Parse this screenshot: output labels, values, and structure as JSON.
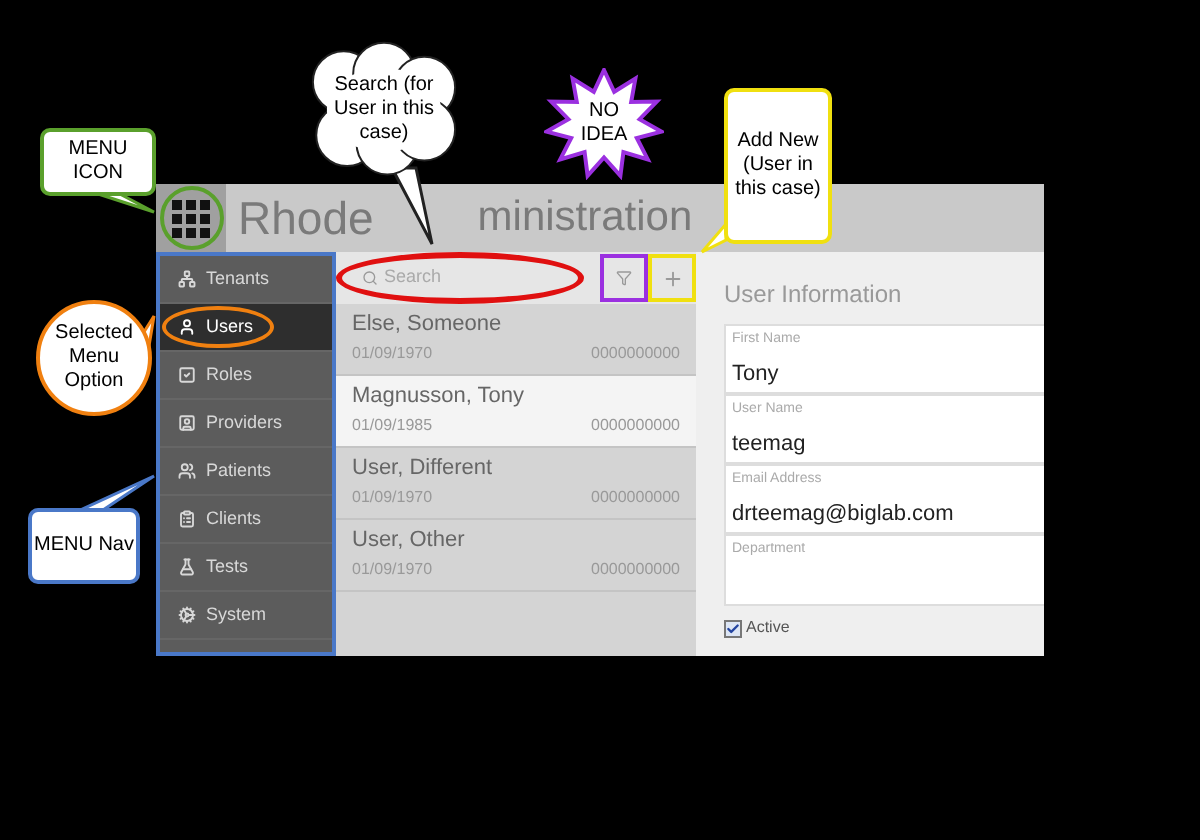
{
  "title_parts": [
    "Rhode",
    "ministration"
  ],
  "nav": [
    {
      "label": "Tenants",
      "selected": false
    },
    {
      "label": "Users",
      "selected": true
    },
    {
      "label": "Roles",
      "selected": false
    },
    {
      "label": "Providers",
      "selected": false
    },
    {
      "label": "Patients",
      "selected": false
    },
    {
      "label": "Clients",
      "selected": false
    },
    {
      "label": "Tests",
      "selected": false
    },
    {
      "label": "System",
      "selected": false
    }
  ],
  "search": {
    "placeholder": "Search"
  },
  "users": [
    {
      "name": "Else, Someone",
      "date": "01/09/1970",
      "number": "0000000000",
      "selected": false
    },
    {
      "name": "Magnusson, Tony",
      "date": "01/09/1985",
      "number": "0000000000",
      "selected": true
    },
    {
      "name": "User, Different",
      "date": "01/09/1970",
      "number": "0000000000",
      "selected": false
    },
    {
      "name": "User, Other",
      "date": "01/09/1970",
      "number": "0000000000",
      "selected": false
    }
  ],
  "form": {
    "title": "User Information",
    "fields": [
      {
        "label": "First Name",
        "value": "Tony"
      },
      {
        "label": "User Name",
        "value": "teemag"
      },
      {
        "label": "Email Address",
        "value": "drteemag@biglab.com"
      },
      {
        "label": "Department"
      }
    ],
    "active": {
      "label": "Active",
      "checked": true
    }
  },
  "annotations": [
    {
      "kind": "box",
      "text": "MENU ICON",
      "color": "#5aa02c"
    },
    {
      "kind": "cloud",
      "text": "Search (for User in this case)",
      "color": "#e01010"
    },
    {
      "kind": "burst",
      "text": "NO IDEA",
      "color": "#9b30e0"
    },
    {
      "kind": "box",
      "text": "Add New (User in this case)",
      "color": "#f0e010"
    },
    {
      "kind": "circle",
      "text": "Selected Menu Option",
      "color": "#f08010"
    },
    {
      "kind": "box",
      "text": "MENU Nav",
      "color": "#4a78c8"
    }
  ]
}
